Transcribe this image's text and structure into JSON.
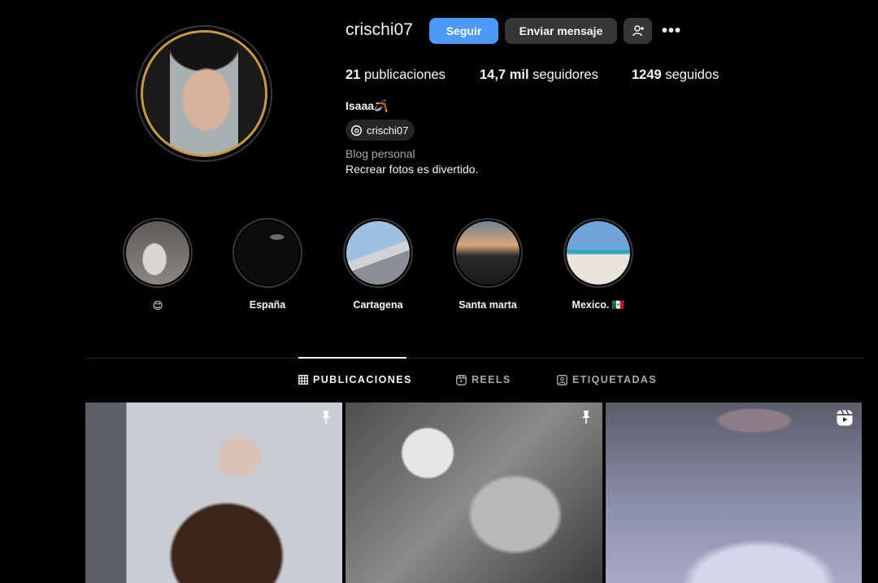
{
  "profile": {
    "username": "crischi07",
    "follow_label": "Seguir",
    "message_label": "Enviar mensaje",
    "add_friend_icon": "person-plus-icon",
    "more_icon": "•••",
    "ring_color": "#c99a3c"
  },
  "stats": {
    "posts_value": "21",
    "posts_label": "publicaciones",
    "followers_value": "14,7 mil",
    "followers_label": "seguidores",
    "following_value": "1249",
    "following_label": "seguidos"
  },
  "bio": {
    "display_name": "Isaaa🪃",
    "threads_handle": "crischi07",
    "category": "Blog personal",
    "text": "Recrear fotos es divertido."
  },
  "highlights": [
    {
      "label": "😊"
    },
    {
      "label": "España"
    },
    {
      "label": "Cartagena"
    },
    {
      "label": "Santa marta"
    },
    {
      "label": "Mexico. 🇲🇽"
    }
  ],
  "tabs": [
    {
      "label": "PUBLICACIONES",
      "icon": "grid-icon",
      "active": true
    },
    {
      "label": "REELS",
      "icon": "reels-icon",
      "active": false
    },
    {
      "label": "ETIQUETADAS",
      "icon": "tagged-icon",
      "active": false
    }
  ],
  "posts": [
    {
      "badge": "pin-icon"
    },
    {
      "badge": "pin-icon"
    },
    {
      "badge": "reel-icon"
    }
  ],
  "colors": {
    "accent": "#4b9af5",
    "button_secondary": "#363636",
    "background": "#000000"
  }
}
